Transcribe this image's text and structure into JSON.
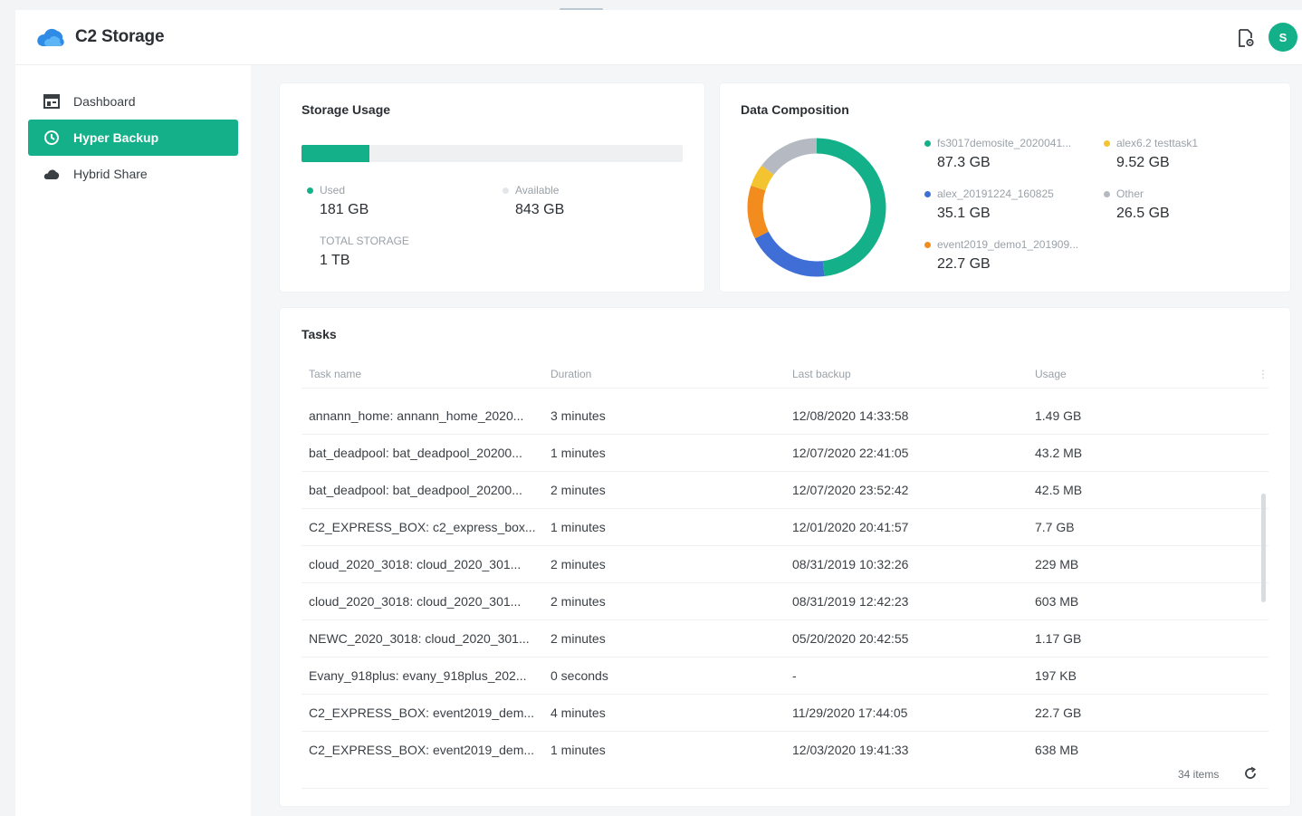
{
  "app": {
    "title": "C2 Storage",
    "avatar_initial": "S"
  },
  "colors": {
    "accent": "#14b08a",
    "blue": "#3f6fd6",
    "orange": "#f28c1e",
    "yellow": "#f4c430",
    "gray": "#b4b9c2"
  },
  "icons": {
    "logo": "cloud-logo-icon",
    "header_action": "file-settings-icon",
    "refresh": "refresh-icon"
  },
  "sidebar": {
    "items": [
      {
        "label": "Dashboard",
        "icon": "dashboard-icon",
        "active": false
      },
      {
        "label": "Hyper Backup",
        "icon": "backup-icon",
        "active": true
      },
      {
        "label": "Hybrid Share",
        "icon": "cloud-icon",
        "active": false
      }
    ]
  },
  "storage": {
    "title": "Storage Usage",
    "used_fraction": 0.177,
    "used_label": "Used",
    "used_value": "181 GB",
    "available_label": "Available",
    "available_value": "843 GB",
    "total_label": "TOTAL STORAGE",
    "total_value": "1 TB"
  },
  "composition": {
    "title": "Data Composition",
    "legend": [
      {
        "label": "fs3017demosite_2020041...",
        "value": "87.3 GB",
        "color": "#14b08a"
      },
      {
        "label": "alex6.2 testtask1",
        "value": "9.52 GB",
        "color": "#f4c430"
      },
      {
        "label": "alex_20191224_160825",
        "value": "35.1 GB",
        "color": "#3f6fd6"
      },
      {
        "label": "Other",
        "value": "26.5 GB",
        "color": "#b4b9c2"
      },
      {
        "label": "event2019_demo1_201909...",
        "value": "22.7 GB",
        "color": "#f28c1e"
      }
    ]
  },
  "chart_data": {
    "type": "pie",
    "categories": [
      "fs3017demosite_2020041...",
      "alex_20191224_160825",
      "event2019_demo1_201909...",
      "alex6.2 testtask1",
      "Other"
    ],
    "values": [
      87.3,
      35.1,
      22.7,
      9.52,
      26.5
    ],
    "colors": [
      "#14b08a",
      "#3f6fd6",
      "#f28c1e",
      "#f4c430",
      "#b4b9c2"
    ]
  },
  "tasks": {
    "title": "Tasks",
    "columns": [
      "Task name",
      "Duration",
      "Last backup",
      "Usage"
    ],
    "rows": [
      [
        "annann_home: annann_home_2020...",
        "3 minutes",
        "12/08/2020 14:33:58",
        "1.49 GB"
      ],
      [
        "bat_deadpool: bat_deadpool_20200...",
        "1 minutes",
        "12/07/2020 22:41:05",
        "43.2 MB"
      ],
      [
        "bat_deadpool: bat_deadpool_20200...",
        "2 minutes",
        "12/07/2020 23:52:42",
        "42.5 MB"
      ],
      [
        "C2_EXPRESS_BOX: c2_express_box...",
        "1 minutes",
        "12/01/2020 20:41:57",
        "7.7 GB"
      ],
      [
        "cloud_2020_3018: cloud_2020_301...",
        "2 minutes",
        "08/31/2019 10:32:26",
        "229 MB"
      ],
      [
        "cloud_2020_3018: cloud_2020_301...",
        "2 minutes",
        "08/31/2019 12:42:23",
        "603 MB"
      ],
      [
        "NEWC_2020_3018: cloud_2020_301...",
        "2 minutes",
        "05/20/2020 20:42:55",
        "1.17 GB"
      ],
      [
        "Evany_918plus: evany_918plus_202...",
        "0 seconds",
        "-",
        "197 KB"
      ],
      [
        "C2_EXPRESS_BOX: event2019_dem...",
        "4 minutes",
        "11/29/2020 17:44:05",
        "22.7 GB"
      ],
      [
        "C2_EXPRESS_BOX: event2019_dem...",
        "1 minutes",
        "12/03/2020 19:41:33",
        "638 MB"
      ]
    ],
    "count_label": "34 items"
  }
}
